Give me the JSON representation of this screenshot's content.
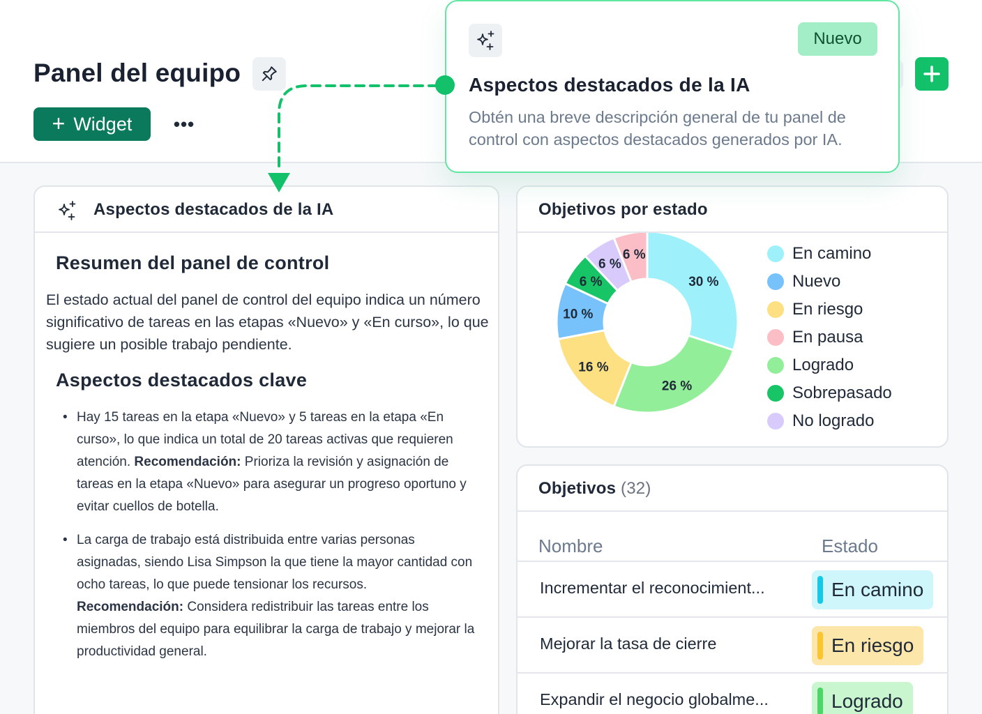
{
  "header": {
    "title": "Panel del equipo",
    "widget_label": "Widget",
    "more_label": "•••"
  },
  "popover": {
    "badge": "Nuevo",
    "title": "Aspectos destacados de la IA",
    "description": "Obtén una breve descripción general de tu panel de control con aspectos destacados generados por IA."
  },
  "ai_card": {
    "title": "Aspectos destacados de la IA",
    "summary_heading": "Resumen del panel de control",
    "summary_text": "El estado actual del panel de control del equipo indica un número significativo de tareas en las etapas «Nuevo» y «En curso», lo que sugiere un posible trabajo pendiente.",
    "key_heading": "Aspectos destacados clave",
    "bullets": [
      {
        "text": "Hay 15 tareas en la etapa «Nuevo» y 5 tareas en la etapa «En curso», lo que indica un total de 20 tareas activas que requieren atención.",
        "rec_label": "Recomendación:",
        "rec_text": "Prioriza la revisión y asignación de tareas en la etapa «Nuevo» para asegurar un progreso oportuno y evitar cuellos de botella."
      },
      {
        "text": "La carga de trabajo está distribuida entre varias personas asignadas, siendo Lisa Simpson la que tiene la mayor cantidad con ocho tareas, lo que puede tensionar los recursos.",
        "rec_label": "Recomendación:",
        "rec_text": "Considera redistribuir las tareas entre los miembros del equipo para equilibrar la carga de trabajo y mejorar la productividad general."
      }
    ]
  },
  "chart_card": {
    "title": "Objetivos por estado"
  },
  "chart_data": {
    "type": "pie",
    "donut": true,
    "categories": [
      "En camino",
      "Nuevo",
      "En riesgo",
      "En pausa",
      "Logrado",
      "Sobrepasado",
      "No logrado"
    ],
    "slices": [
      {
        "name": "En camino",
        "value": 30,
        "label": "30 %",
        "color": "#9ef0fb"
      },
      {
        "name": "Logrado",
        "value": 26,
        "label": "26 %",
        "color": "#93ee9a"
      },
      {
        "name": "En riesgo",
        "value": 16,
        "label": "16 %",
        "color": "#fde082"
      },
      {
        "name": "Nuevo",
        "value": 10,
        "label": "10 %",
        "color": "#77c2fb"
      },
      {
        "name": "Sobrepasado",
        "value": 6,
        "label": "6 %",
        "color": "#17c466"
      },
      {
        "name": "No logrado",
        "value": 6,
        "label": "6 %",
        "color": "#d8cbfb"
      },
      {
        "name": "En pausa",
        "value": 6,
        "label": "6 %",
        "color": "#fbbdc6"
      }
    ],
    "legend": [
      {
        "label": "En camino",
        "color": "#9ef0fb"
      },
      {
        "label": "Nuevo",
        "color": "#77c2fb"
      },
      {
        "label": "En riesgo",
        "color": "#fde082"
      },
      {
        "label": "En pausa",
        "color": "#fbbdc6"
      },
      {
        "label": "Logrado",
        "color": "#93ee9a"
      },
      {
        "label": "Sobrepasado",
        "color": "#17c466"
      },
      {
        "label": "No logrado",
        "color": "#d8cbfb"
      }
    ],
    "legend_placement": "right"
  },
  "objectives": {
    "title": "Objetivos",
    "count": "(32)",
    "columns": [
      "Nombre",
      "Estado"
    ],
    "rows": [
      {
        "name": "Incrementar el reconocimient...",
        "status": "En camino",
        "bg": "#cff6fb",
        "accent": "#17c9e6"
      },
      {
        "name": "Mejorar la tasa de cierre",
        "status": "En riesgo",
        "bg": "#fde6aa",
        "accent": "#fbc531"
      },
      {
        "name": "Expandir el negocio globalme...",
        "status": "Logrado",
        "bg": "#c9f5cf",
        "accent": "#4cd667"
      }
    ]
  }
}
